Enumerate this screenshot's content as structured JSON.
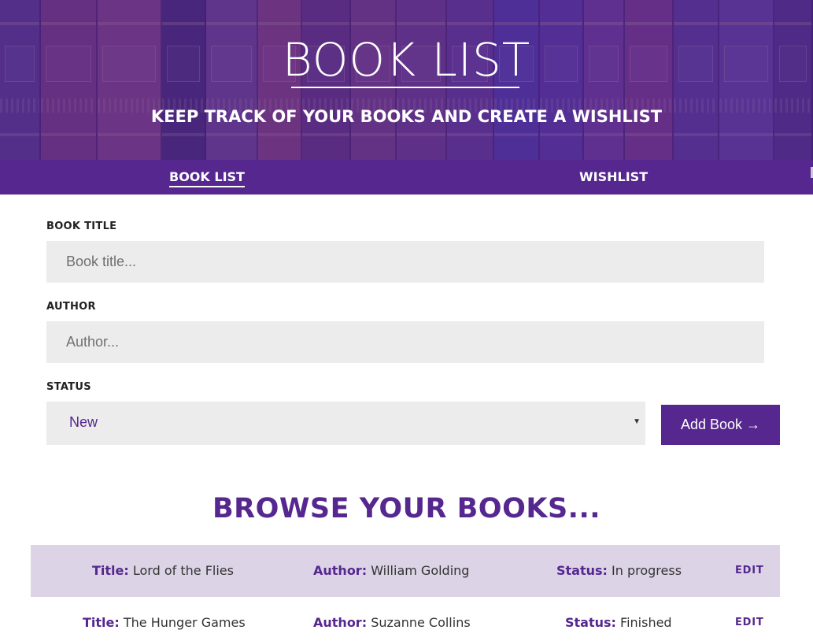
{
  "header": {
    "title": "BOOK LIST",
    "subtitle": "KEEP TRACK OF YOUR BOOKS AND CREATE A WISHLIST"
  },
  "nav": {
    "tabs": [
      {
        "label": "BOOK LIST",
        "active": true
      },
      {
        "label": "WISHLIST",
        "active": false
      }
    ]
  },
  "form": {
    "title_label": "BOOK TITLE",
    "title_placeholder": "Book title...",
    "author_label": "AUTHOR",
    "author_placeholder": "Author...",
    "status_label": "STATUS",
    "status_value": "New",
    "submit_label": "Add Book →"
  },
  "books": {
    "heading": "BROWSE YOUR BOOKS...",
    "title_prefix": "Title:",
    "author_prefix": "Author:",
    "status_prefix": "Status:",
    "edit_label": "EDIT",
    "rows": [
      {
        "title": "Lord of the Flies",
        "author": "William Golding",
        "status": "In progress"
      },
      {
        "title": "The Hunger Games",
        "author": "Suzanne Collins",
        "status": "Finished"
      }
    ]
  },
  "colors": {
    "accent": "#55278f",
    "input_bg": "#ececec",
    "row_alt_bg": "#dcd3e6"
  }
}
